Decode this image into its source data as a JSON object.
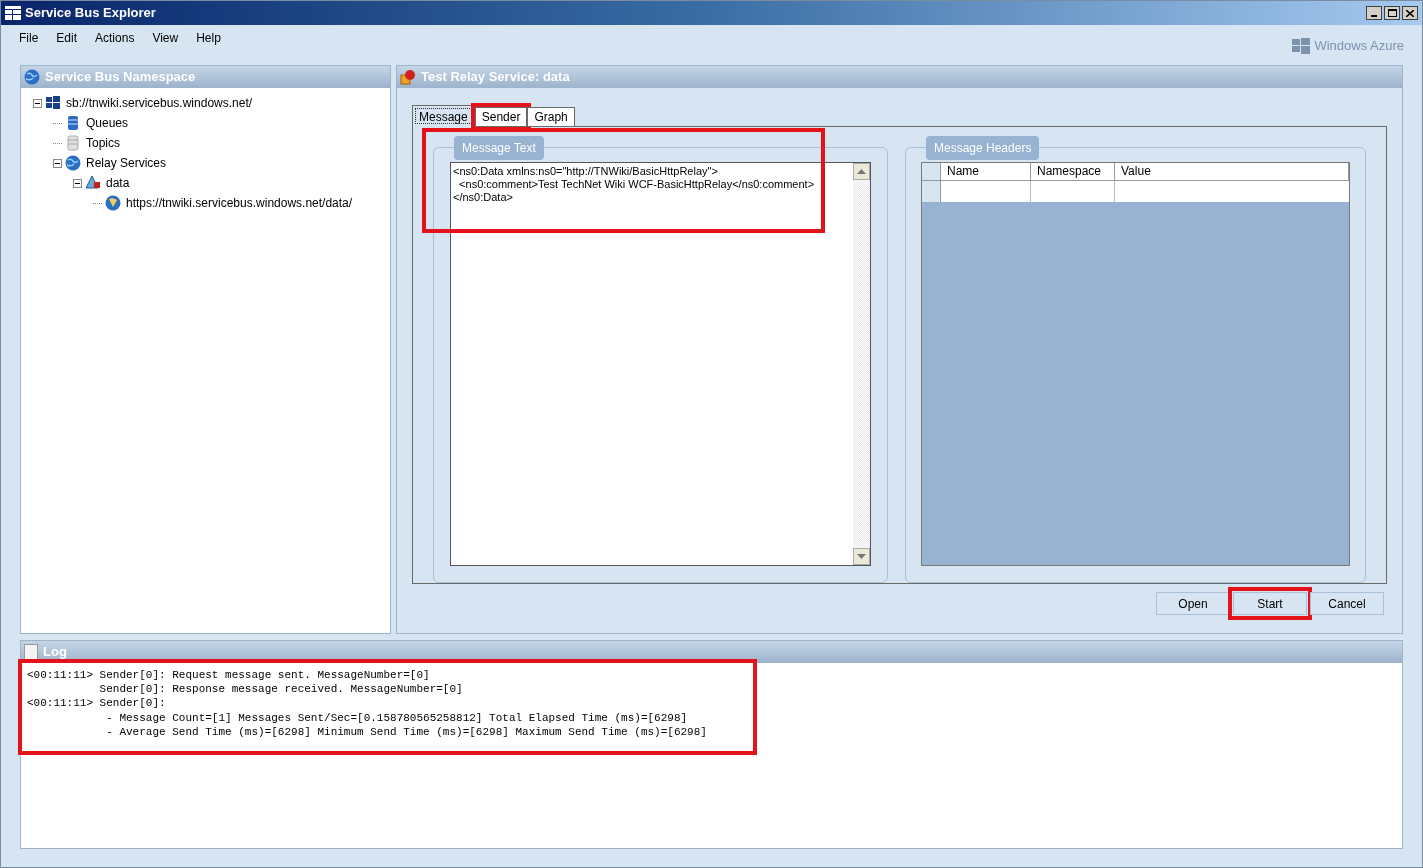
{
  "window": {
    "title": "Service Bus Explorer"
  },
  "menu": [
    "File",
    "Edit",
    "Actions",
    "View",
    "Help"
  ],
  "brand": "Windows Azure",
  "namespace_panel": {
    "title": "Service Bus Namespace",
    "tree": [
      {
        "label": "sb://tnwiki.servicebus.windows.net/",
        "kind": "namespace",
        "expanded": true,
        "children": [
          {
            "label": "Queues",
            "kind": "queues"
          },
          {
            "label": "Topics",
            "kind": "topics"
          },
          {
            "label": "Relay Services",
            "kind": "relay",
            "expanded": true,
            "children": [
              {
                "label": "data",
                "kind": "service",
                "expanded": true,
                "children": [
                  {
                    "label": "https://tnwiki.servicebus.windows.net/data/",
                    "kind": "endpoint"
                  }
                ]
              }
            ]
          }
        ]
      }
    ]
  },
  "relay_panel": {
    "title": "Test Relay Service: data",
    "tabs": [
      {
        "label": "Message",
        "selected": true,
        "highlighted": false
      },
      {
        "label": "Sender",
        "selected": false,
        "highlighted": true
      },
      {
        "label": "Graph",
        "selected": false,
        "highlighted": false
      }
    ],
    "message_text": {
      "legend": "Message Text",
      "highlighted": true,
      "lines": [
        "<ns0:Data xmlns:ns0=\"http://TNWiki/BasicHttpRelay\">",
        "  <ns0:comment>Test TechNet Wiki WCF-BasicHttpRelay</ns0:comment>",
        "</ns0:Data>"
      ]
    },
    "message_headers": {
      "legend": "Message Headers",
      "columns": [
        "Name",
        "Namespace",
        "Value"
      ]
    },
    "buttons": [
      {
        "label": "Open",
        "highlighted": false
      },
      {
        "label": "Start",
        "highlighted": true
      },
      {
        "label": "Cancel",
        "highlighted": false
      }
    ]
  },
  "log": {
    "title": "Log",
    "highlighted": true,
    "lines": [
      "<00:11:11> Sender[0]: Request message sent. MessageNumber=[0]",
      "           Sender[0]: Response message received. MessageNumber=[0]",
      "<00:11:11> Sender[0]:",
      "            - Message Count=[1] Messages Sent/Sec=[0.158780565258812] Total Elapsed Time (ms)=[6298]",
      "            - Average Send Time (ms)=[6298] Minimum Send Time (ms)=[6298] Maximum Send Time (ms)=[6298]"
    ]
  }
}
